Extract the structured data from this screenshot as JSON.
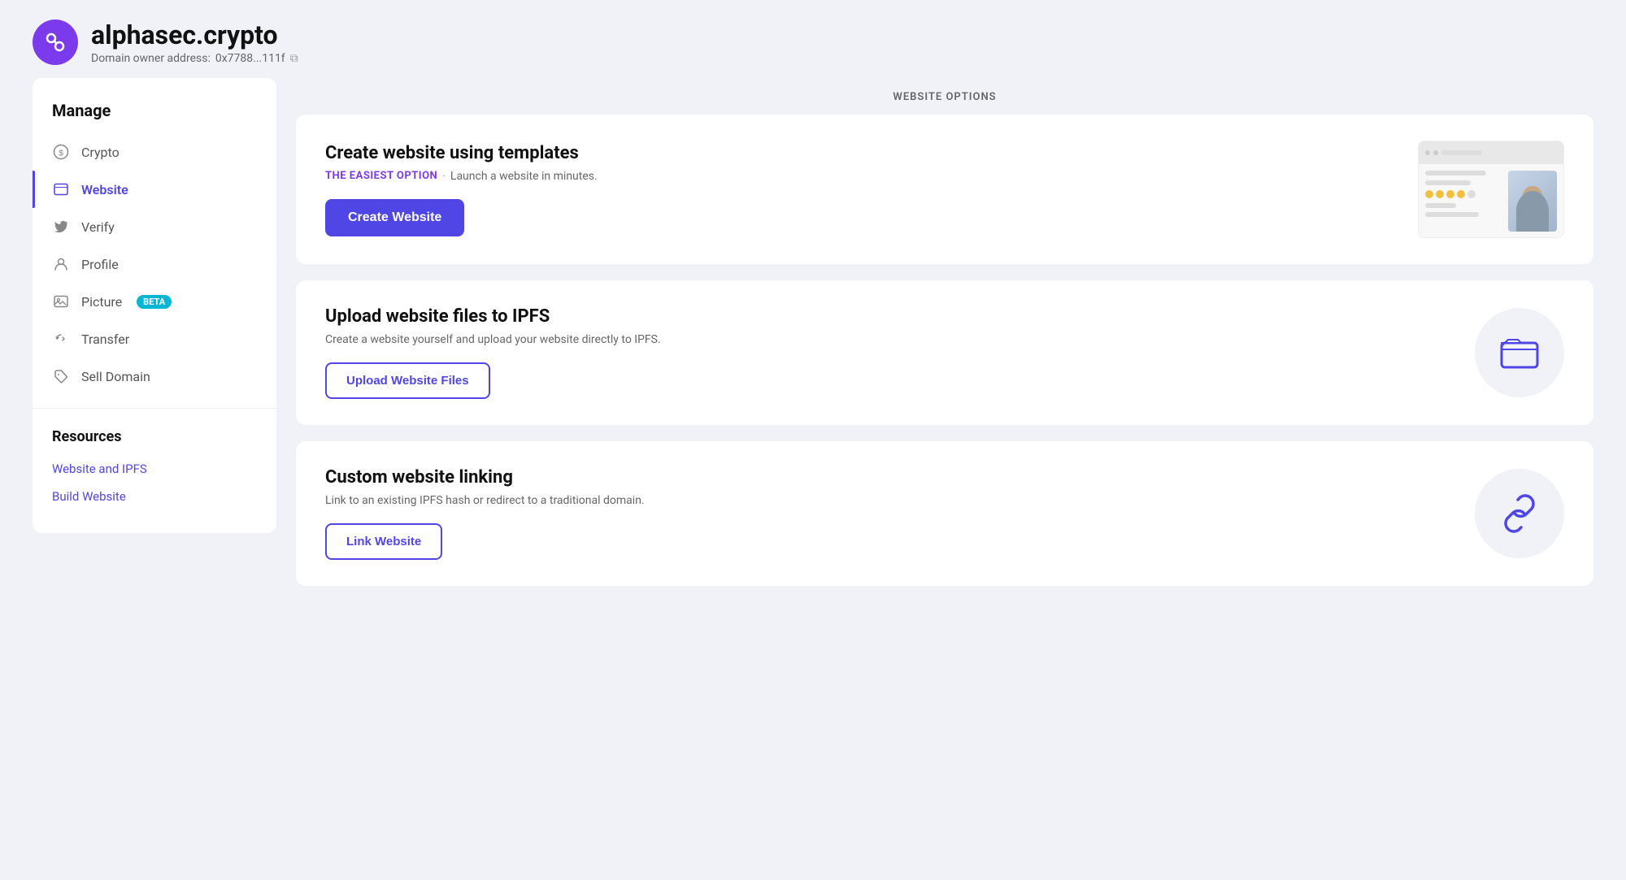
{
  "header": {
    "domain": "alphasec.crypto",
    "owner_label": "Domain owner address:",
    "owner_address": "0x7788...111f"
  },
  "sidebar": {
    "manage_title": "Manage",
    "items": [
      {
        "id": "crypto",
        "label": "Crypto",
        "icon": "dollar-circle"
      },
      {
        "id": "website",
        "label": "Website",
        "icon": "browser",
        "active": true
      },
      {
        "id": "verify",
        "label": "Verify",
        "icon": "twitter"
      },
      {
        "id": "profile",
        "label": "Profile",
        "icon": "person"
      },
      {
        "id": "picture",
        "label": "Picture",
        "icon": "image",
        "badge": "BETA"
      },
      {
        "id": "transfer",
        "label": "Transfer",
        "icon": "transfer"
      },
      {
        "id": "sell-domain",
        "label": "Sell Domain",
        "icon": "tag"
      }
    ],
    "resources_title": "Resources",
    "resource_links": [
      {
        "id": "website-ipfs",
        "label": "Website and IPFS"
      },
      {
        "id": "build-website",
        "label": "Build Website"
      }
    ]
  },
  "content": {
    "section_title": "WEBSITE OPTIONS",
    "cards": [
      {
        "id": "create-website",
        "title": "Create website using templates",
        "easiest_badge": "THE EASIEST OPTION",
        "dot": "·",
        "subtitle": "Launch a website in minutes.",
        "button_label": "Create Website",
        "button_type": "primary"
      },
      {
        "id": "upload-website",
        "title": "Upload website files to IPFS",
        "subtitle": "Create a website yourself and upload your website directly to IPFS.",
        "button_label": "Upload Website Files",
        "button_type": "outline"
      },
      {
        "id": "custom-linking",
        "title": "Custom website linking",
        "subtitle": "Link to an existing IPFS hash or redirect to a traditional domain.",
        "button_label": "Link Website",
        "button_type": "outline"
      }
    ]
  }
}
